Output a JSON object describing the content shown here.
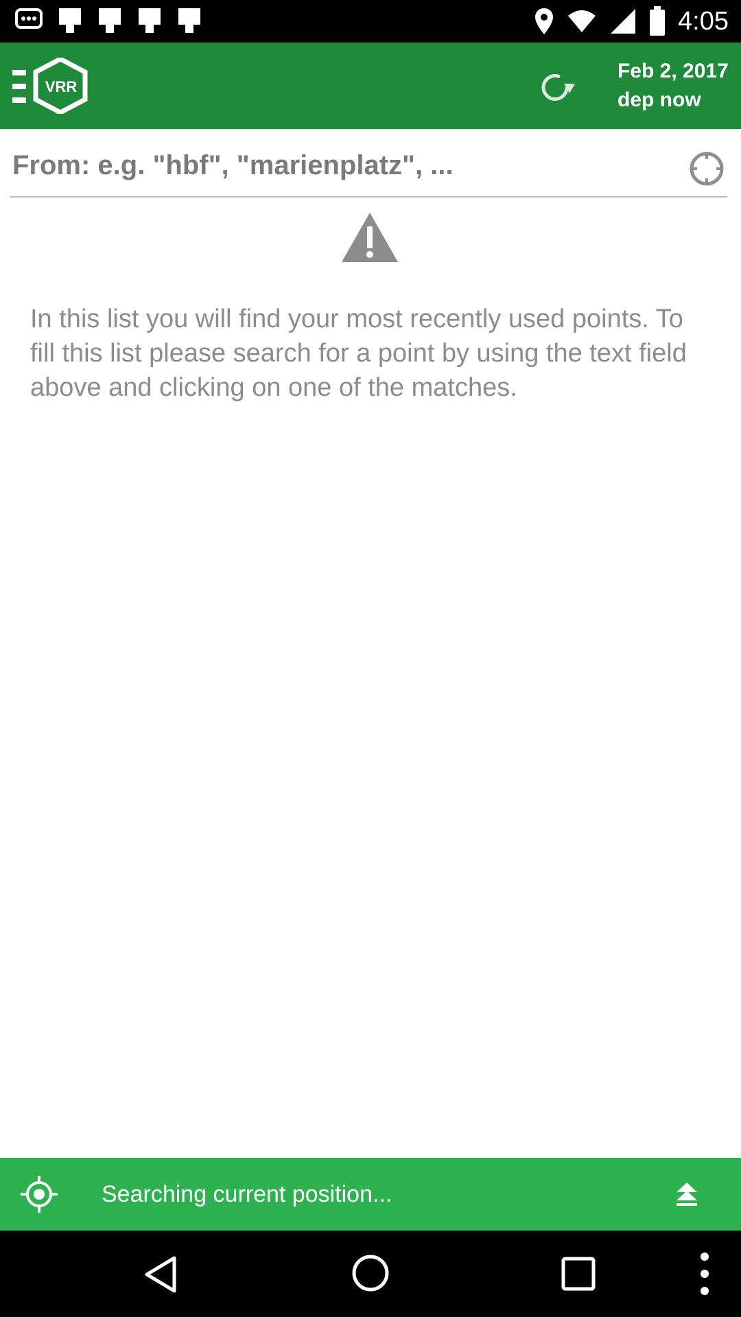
{
  "status_bar": {
    "time": "4:05",
    "icons": [
      "message-icon",
      "notification-icon",
      "notification-icon",
      "notification-icon",
      "notification-icon",
      "location-icon",
      "wifi-icon",
      "signal-icon",
      "battery-icon"
    ]
  },
  "app_bar": {
    "logo_text": "VRR",
    "date": "Feb 2, 2017",
    "departure": "dep now",
    "background_color": "#1f8a3a"
  },
  "search": {
    "from_placeholder": "From: e.g. \"hbf\", \"marienplatz\", ...",
    "from_value": ""
  },
  "empty_state": {
    "message": "In this list you will find your most recently used points. To fill this list please search for a point by using the text field above and clicking on one of the matches."
  },
  "position_bar": {
    "status_text": "Searching current position...",
    "background_color": "#2eb24f"
  }
}
